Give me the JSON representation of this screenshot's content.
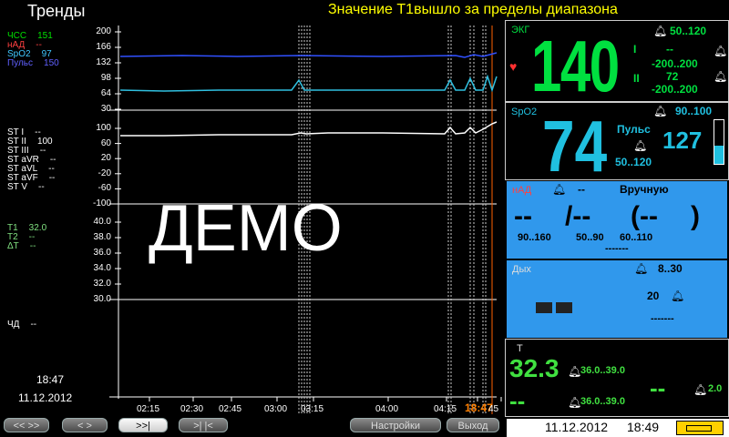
{
  "header": {
    "title": "Тренды",
    "alarm": "Значение T1вышло за пределы диапазона"
  },
  "left": {
    "group1": [
      {
        "label": "ЧСС",
        "value": "151",
        "color": "#00e000"
      },
      {
        "label": "нАД",
        "value": "--",
        "color": "#ff4040"
      },
      {
        "label": "SpO2",
        "value": "97",
        "color": "#40c8ff"
      },
      {
        "label": "Пульс",
        "value": "150",
        "color": "#6060ff"
      }
    ],
    "group2": [
      {
        "label": "ST I",
        "value": "--"
      },
      {
        "label": "ST II",
        "value": "100"
      },
      {
        "label": "ST III",
        "value": "--"
      },
      {
        "label": "ST aVR",
        "value": "--"
      },
      {
        "label": "ST aVL",
        "value": "--"
      },
      {
        "label": "ST aVF",
        "value": "--"
      },
      {
        "label": "ST V",
        "value": "--"
      }
    ],
    "group3": [
      {
        "label": "T1",
        "value": "32.0",
        "color": "#80e080"
      },
      {
        "label": "T2",
        "value": "--",
        "color": "#80e080"
      },
      {
        "label": "ΔT",
        "value": "--",
        "color": "#80e080"
      }
    ],
    "group4": [
      {
        "label": "ЧД",
        "value": "--"
      }
    ],
    "time": "18:47",
    "date": "11.12.2012"
  },
  "trend": {
    "axis1": [
      "200",
      "166",
      "132",
      "98",
      "64",
      "30"
    ],
    "axis2": [
      "100",
      "60",
      "20",
      "-20",
      "-60",
      "-100"
    ],
    "axis3": [
      "40.0",
      "38.0",
      "36.0",
      "34.0",
      "32.0",
      "30.0"
    ],
    "xticks": [
      "02:15",
      "02:30",
      "02:45",
      "03:00",
      "03:15",
      "04:00",
      "04:15",
      "18:47",
      "45"
    ],
    "watermark": "ДЕМО"
  },
  "ecg": {
    "label": "ЭКГ",
    "hr": "140",
    "alarm_range": "50..120",
    "lead1": "I",
    "lead2": "II",
    "st1": "--",
    "st1_range": "-200..200",
    "st2": "72",
    "st2_range": "-200..200",
    "colors": {
      "main": "#00e040"
    }
  },
  "spo2": {
    "label": "SpO2",
    "value": "74",
    "range": "90..100",
    "pulse_label": "Пульс",
    "pulse": "127",
    "pulse_range": "50..120",
    "colors": {
      "main": "#20c0e0"
    }
  },
  "nibp": {
    "label": "нАД",
    "mode": "Вручную",
    "alarm": "--",
    "sys": "--",
    "slash": "/--",
    "map": "(--",
    "close": ")",
    "sys_range": "90..160",
    "dia_range": "50..90",
    "map_range": "60..110",
    "dashes": "-------"
  },
  "resp": {
    "label": "Дых",
    "range": "8..30",
    "value_low": "20",
    "bars": "",
    "dashes": "-------"
  },
  "temp": {
    "label": "T",
    "value": "32.3",
    "range1": "36.0..39.0",
    "value2": "--",
    "range2": "36.0..39.0",
    "delta": "--",
    "delta_range": "2.0",
    "colors": {
      "main": "#40e040"
    }
  },
  "footer": {
    "date": "11.12.2012",
    "time": "18:49"
  },
  "buttons": [
    {
      "label": "<< >>",
      "active": false
    },
    {
      "label": "< >",
      "active": false
    },
    {
      "label": ">>|",
      "active": true
    },
    {
      "label": ">| |<",
      "active": false
    },
    {
      "label": "Настройки",
      "active": false
    },
    {
      "label": "Выход",
      "active": false
    }
  ]
}
